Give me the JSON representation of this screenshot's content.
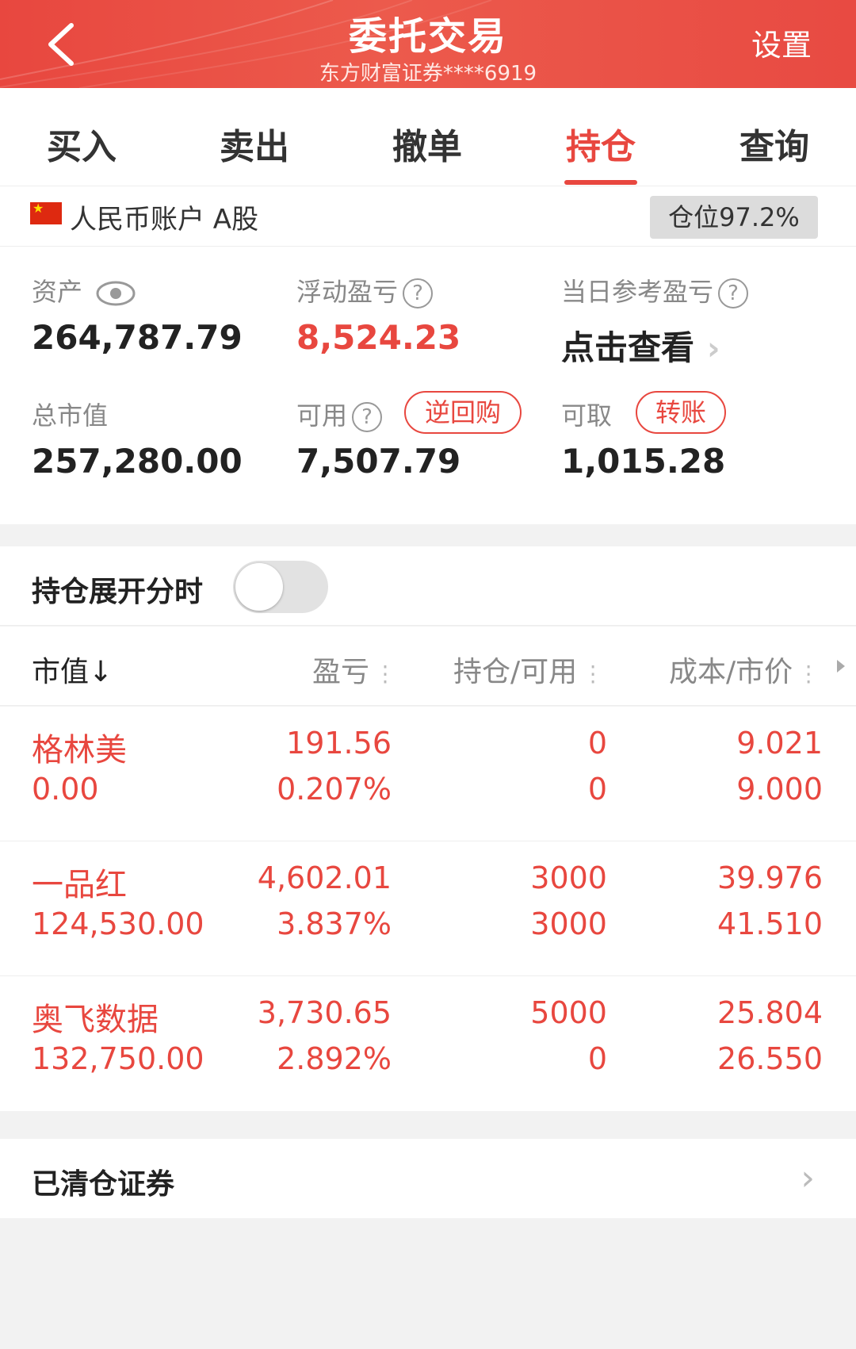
{
  "header": {
    "title": "委托交易",
    "subtitle": "东方财富证券****6919",
    "settings": "设置"
  },
  "tabs": [
    "买入",
    "卖出",
    "撤单",
    "持仓",
    "查询"
  ],
  "active_tab": "持仓",
  "account": {
    "label": "人民币账户 A股",
    "position_badge": "仓位97.2%"
  },
  "summary": {
    "assets_label": "资产",
    "assets_value": "264,787.79",
    "float_pl_label": "浮动盈亏",
    "float_pl_value": "8,524.23",
    "daily_pl_label": "当日参考盈亏",
    "daily_pl_value": "点击查看",
    "market_value_label": "总市值",
    "market_value": "257,280.00",
    "available_label": "可用",
    "available_value": "7,507.79",
    "repo_button": "逆回购",
    "withdrawable_label": "可取",
    "withdrawable_value": "1,015.28",
    "transfer_button": "转账"
  },
  "toggle": {
    "label": "持仓展开分时",
    "on": false
  },
  "table": {
    "headers": [
      "市值↓",
      "盈亏",
      "持仓/可用",
      "成本/市价"
    ],
    "rows": [
      {
        "name": "格林美",
        "market_value": "0.00",
        "pl": "191.56",
        "pl_pct": "0.207%",
        "hold": "0",
        "avail": "0",
        "cost": "9.021",
        "price": "9.000"
      },
      {
        "name": "一品红",
        "market_value": "124,530.00",
        "pl": "4,602.01",
        "pl_pct": "3.837%",
        "hold": "3000",
        "avail": "3000",
        "cost": "39.976",
        "price": "41.510"
      },
      {
        "name": "奥飞数据",
        "market_value": "132,750.00",
        "pl": "3,730.65",
        "pl_pct": "2.892%",
        "hold": "5000",
        "avail": "0",
        "cost": "25.804",
        "price": "26.550"
      }
    ]
  },
  "cleared": {
    "label": "已清仓证券"
  },
  "colors": {
    "accent": "#e8473f",
    "muted": "#888888"
  }
}
